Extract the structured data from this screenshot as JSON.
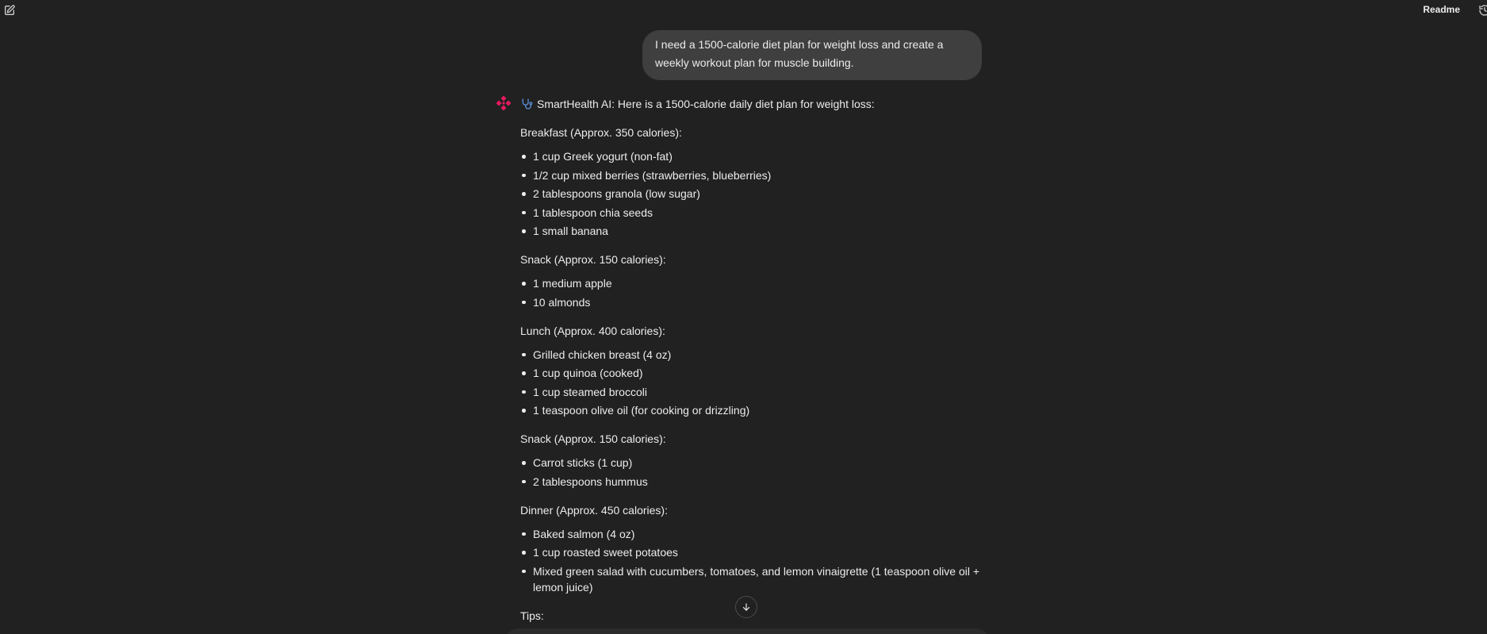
{
  "topbar": {
    "readme_label": "Readme",
    "new_chat_icon": "edit-icon",
    "history_icon": "history-icon"
  },
  "user_message": {
    "text": "I need a 1500-calorie diet plan for weight loss and create a weekly workout plan for muscle building."
  },
  "assistant": {
    "logo_icon": "brand-logo-icon",
    "intro_icon": "stethoscope-icon",
    "intro": "SmartHealth AI: Here is a 1500-calorie daily diet plan for weight loss:",
    "sections": [
      {
        "heading": "Breakfast (Approx. 350 calories):",
        "items": [
          "1 cup Greek yogurt (non-fat)",
          "1/2 cup mixed berries (strawberries, blueberries)",
          "2 tablespoons granola (low sugar)",
          "1 tablespoon chia seeds",
          "1 small banana"
        ]
      },
      {
        "heading": "Snack (Approx. 150 calories):",
        "items": [
          "1 medium apple",
          "10 almonds"
        ]
      },
      {
        "heading": "Lunch (Approx. 400 calories):",
        "items": [
          "Grilled chicken breast (4 oz)",
          "1 cup quinoa (cooked)",
          "1 cup steamed broccoli",
          "1 teaspoon olive oil (for cooking or drizzling)"
        ]
      },
      {
        "heading": "Snack (Approx. 150 calories):",
        "items": [
          "Carrot sticks (1 cup)",
          "2 tablespoons hummus"
        ]
      },
      {
        "heading": "Dinner (Approx. 450 calories):",
        "items": [
          "Baked salmon (4 oz)",
          "1 cup roasted sweet potatoes",
          "Mixed green salad with cucumbers, tomatoes, and lemon vinaigrette (1 teaspoon olive oil + lemon juice)"
        ]
      }
    ],
    "tips_heading": "Tips:"
  },
  "scroll_button_icon": "arrow-down-icon",
  "colors": {
    "background": "#212121",
    "user_bubble": "#3f3f3f",
    "text": "#ececec",
    "brand": "#e5195f",
    "stethoscope": "#5b8fd9"
  }
}
